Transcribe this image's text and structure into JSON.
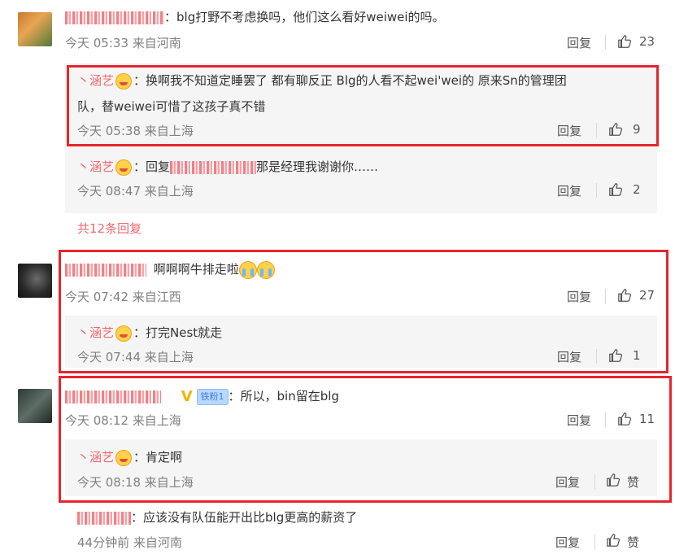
{
  "comments": [
    {
      "text": "：blg打野不考虑换吗，他们这么看好weiwei的吗。",
      "time": "今天 05:33 来自河南",
      "reply": "回复",
      "likes": "23"
    },
    {
      "text": "啊啊啊牛排走啦",
      "time": "今天 07:42 来自江西",
      "reply": "回复",
      "likes": "27"
    },
    {
      "fan_badge": "铁粉1",
      "text": "：所以，bin留在blg",
      "time": "今天 08:12 来自上海",
      "reply": "回复",
      "likes": "11"
    },
    {
      "text": "：应该没有队伍能开出比blg更高的薪资了",
      "time": "44分钟前 来自河南",
      "reply": "回复",
      "likes": "赞"
    }
  ],
  "replies": [
    {
      "name": "丶涵艺",
      "text": "：换啊我不知道定睡罢了 都有聊反正 Blg的人看不起wei'wei的 原来Sn的管理团",
      "text2": "队，替weiwei可惜了这孩子真不错",
      "time": "今天 05:38 来自上海",
      "reply": "回复",
      "likes": "9"
    },
    {
      "name": "丶涵艺",
      "text_prefix": "：回复",
      "text": "那是经理我谢谢你……",
      "time": "今天 08:47 来自上海",
      "reply": "回复",
      "likes": "2"
    },
    {
      "name": "丶涵艺",
      "text": "：打完Nest就走",
      "time": "今天 07:44 来自上海",
      "reply": "回复",
      "likes": "1"
    },
    {
      "name": "丶涵艺",
      "text": "：肯定啊",
      "time": "今天 08:18 来自上海",
      "reply": "回复",
      "likes": "赞"
    }
  ],
  "more_replies": "共12条回复",
  "icons": {
    "like": "thumbs-up-icon",
    "vip": "verified-v-icon",
    "emoji": "emoji-icon"
  },
  "colors": {
    "highlight": "#e6252e",
    "name": "#ec6a70",
    "meta": "#808080"
  }
}
